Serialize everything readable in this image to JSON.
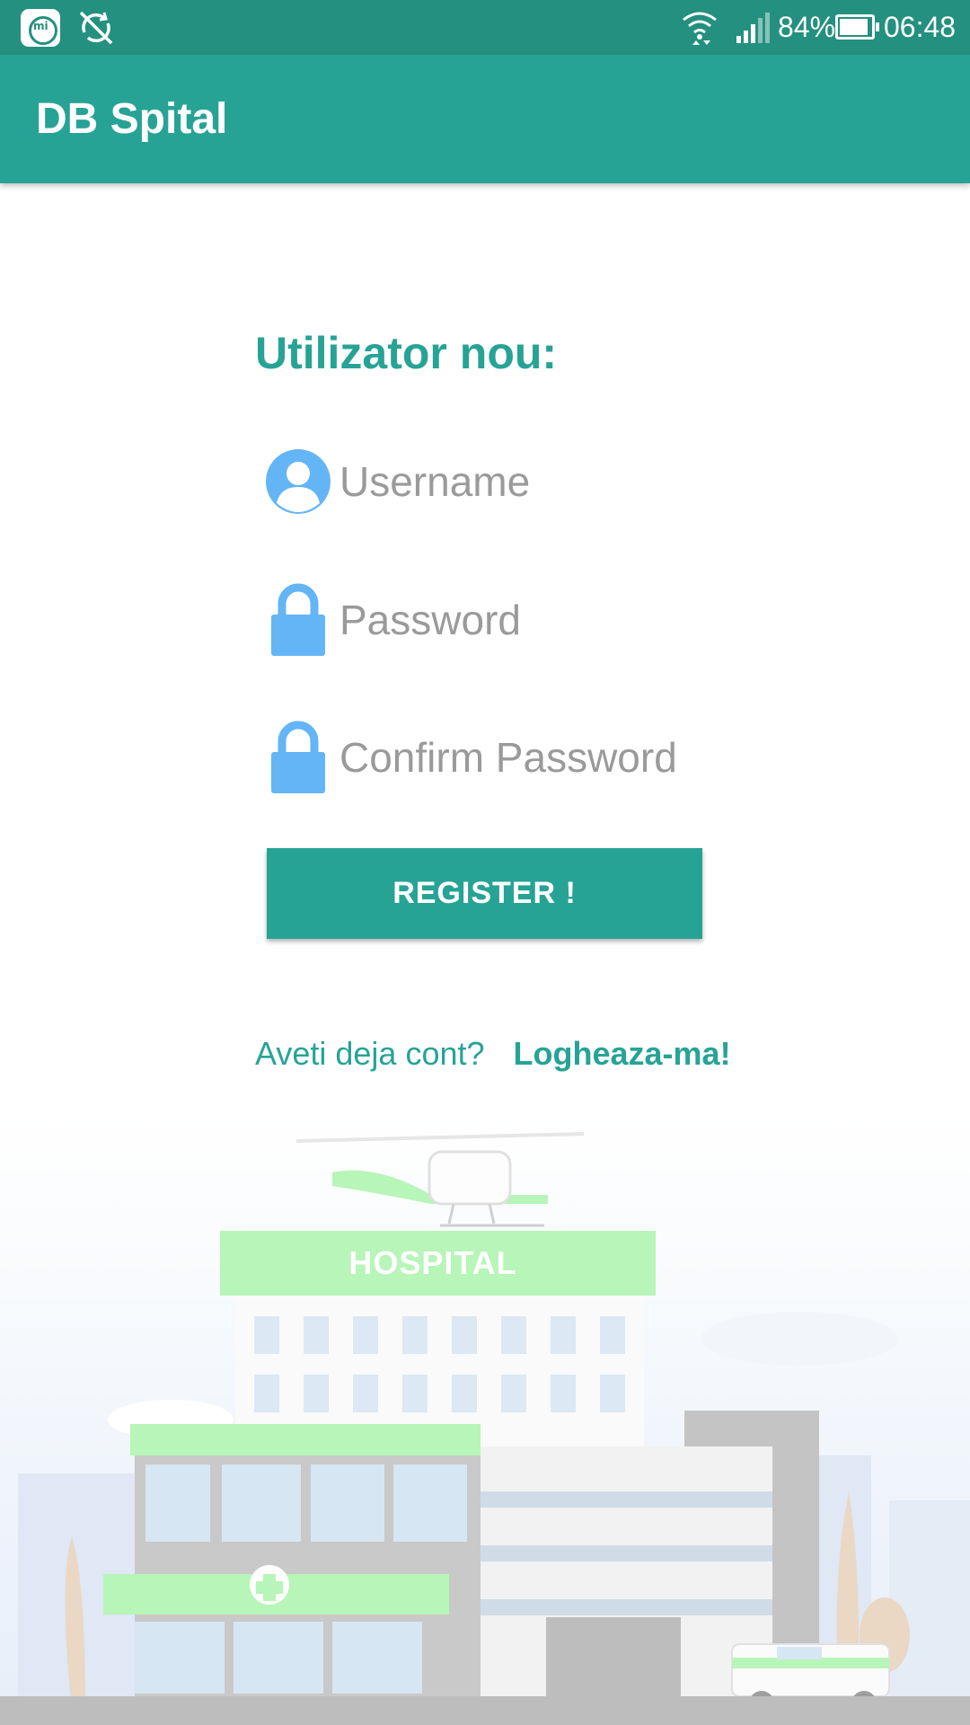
{
  "status_bar": {
    "battery": "84%",
    "time": "06:48",
    "icons": [
      "mi-icon",
      "rotation-off-icon",
      "wifi-icon",
      "signal-icon",
      "battery-icon"
    ]
  },
  "app_bar": {
    "title": "DB Spital"
  },
  "form": {
    "heading": "Utilizator nou:",
    "username_placeholder": "Username",
    "password_placeholder": "Password",
    "confirm_placeholder": "Confirm Password",
    "register_label": "REGISTER !"
  },
  "login": {
    "question": "Aveti deja cont?",
    "link": "Logheaza-ma!"
  },
  "illustration": {
    "sign": "HOSPITAL"
  },
  "colors": {
    "status_bar": "#24907f",
    "primary": "#27a396",
    "icon_blue": "#64b5f6",
    "hint_gray": "#9a9a9a"
  }
}
